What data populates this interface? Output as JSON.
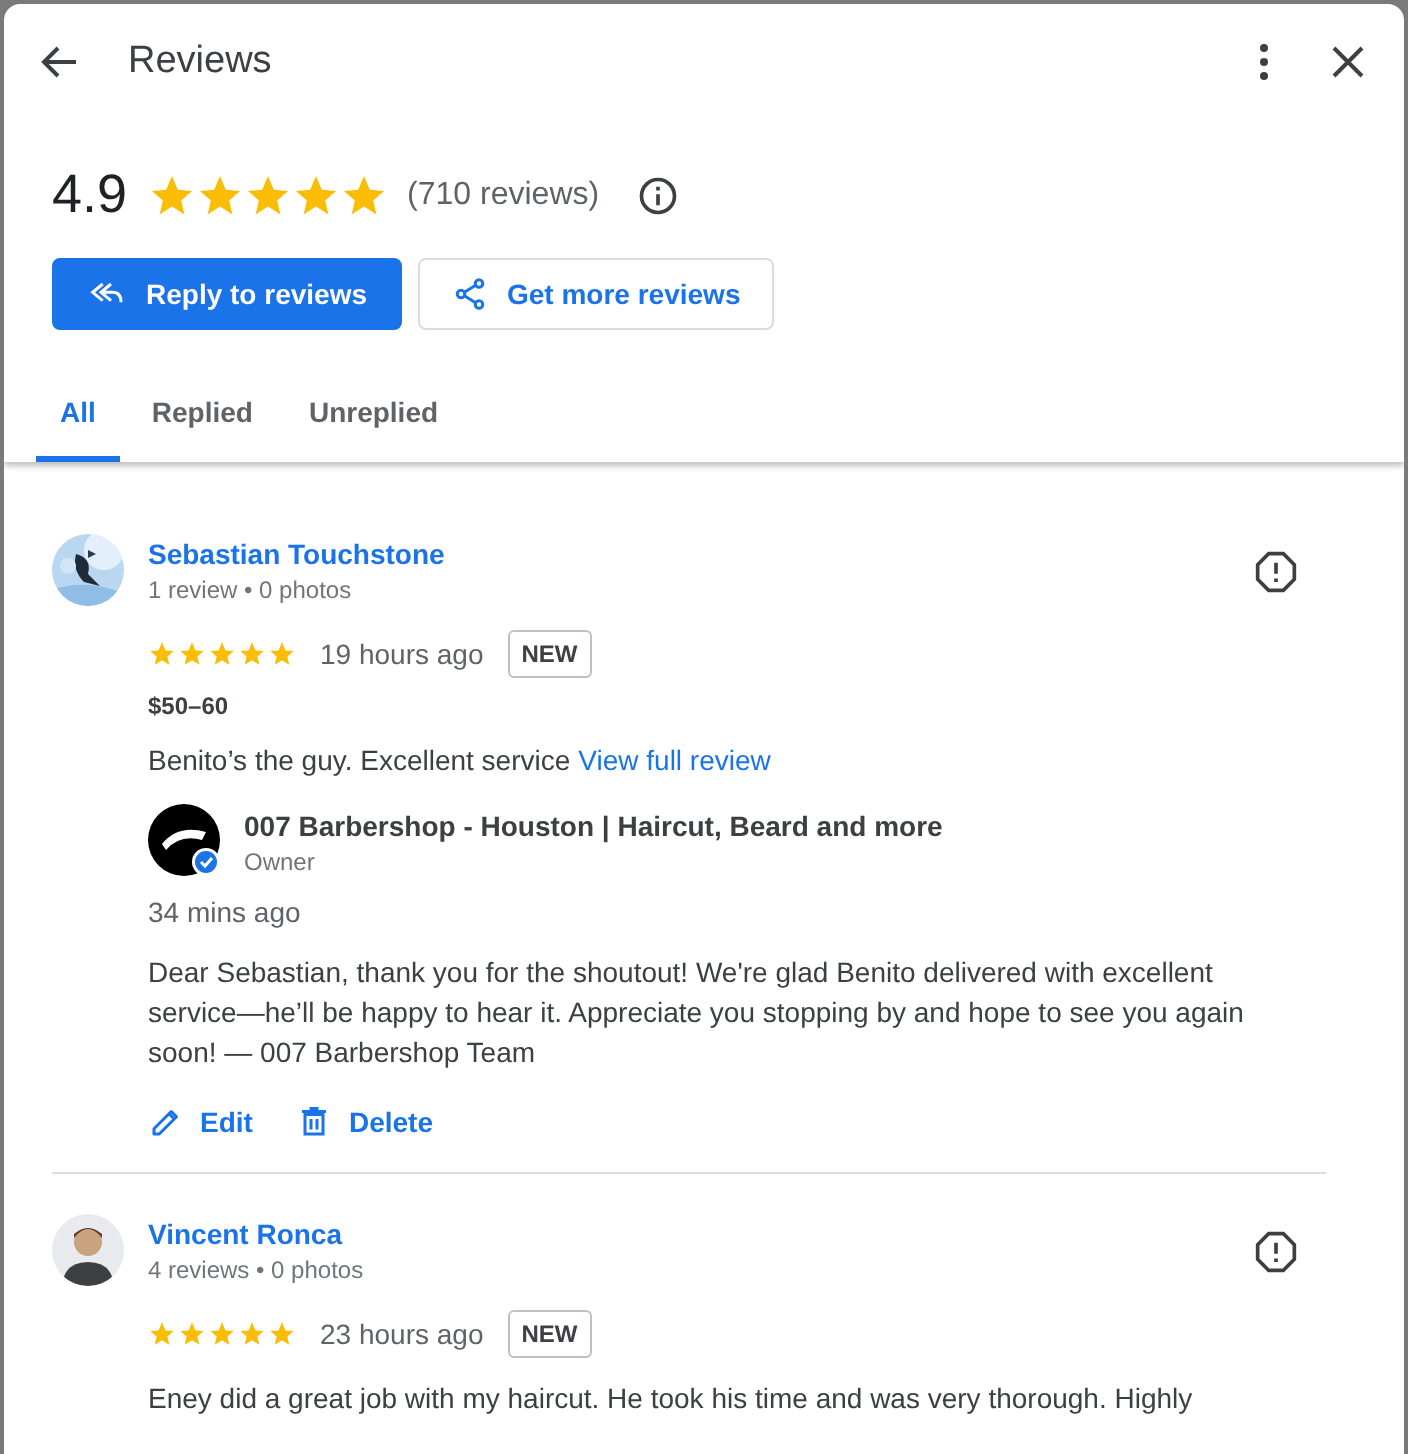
{
  "header": {
    "title": "Reviews"
  },
  "summary": {
    "rating": "4.9",
    "stars": 5,
    "count": "(710 reviews)"
  },
  "buttons": [
    {
      "label": "Reply to reviews",
      "kind": "primary"
    },
    {
      "label": "Get more reviews",
      "kind": "secondary"
    }
  ],
  "tabs": [
    {
      "label": "All",
      "selected": true
    },
    {
      "label": "Replied",
      "selected": false
    },
    {
      "label": "Unreplied",
      "selected": false
    }
  ],
  "reviews": [
    {
      "name": "Sebastian Touchstone",
      "meta": "1 review • 0 photos",
      "stars": 5,
      "time": "19 hours ago",
      "badge": "NEW",
      "price": "$50–60",
      "text": "Benito’s the guy. Excellent service",
      "link": "View full review",
      "reply": {
        "business": "007 Barbershop - Houston | Haircut, Beard and more",
        "role": "Owner",
        "time": "34 mins ago",
        "text": "Dear Sebastian, thank you for the shoutout! We're glad Benito delivered with excellent service—he’ll be happy to hear it. Appreciate you stopping by and hope to see you again soon! — 007 Barbershop Team",
        "actions": [
          {
            "label": "Edit",
            "kind": "edit"
          },
          {
            "label": "Delete",
            "kind": "delete"
          }
        ]
      }
    },
    {
      "name": "Vincent Ronca",
      "meta": "4 reviews • 0 photos",
      "stars": 5,
      "time": "23 hours ago",
      "badge": "NEW",
      "text": "Eney did a great job with my haircut. He took his time and was very thorough. Highly"
    }
  ]
}
